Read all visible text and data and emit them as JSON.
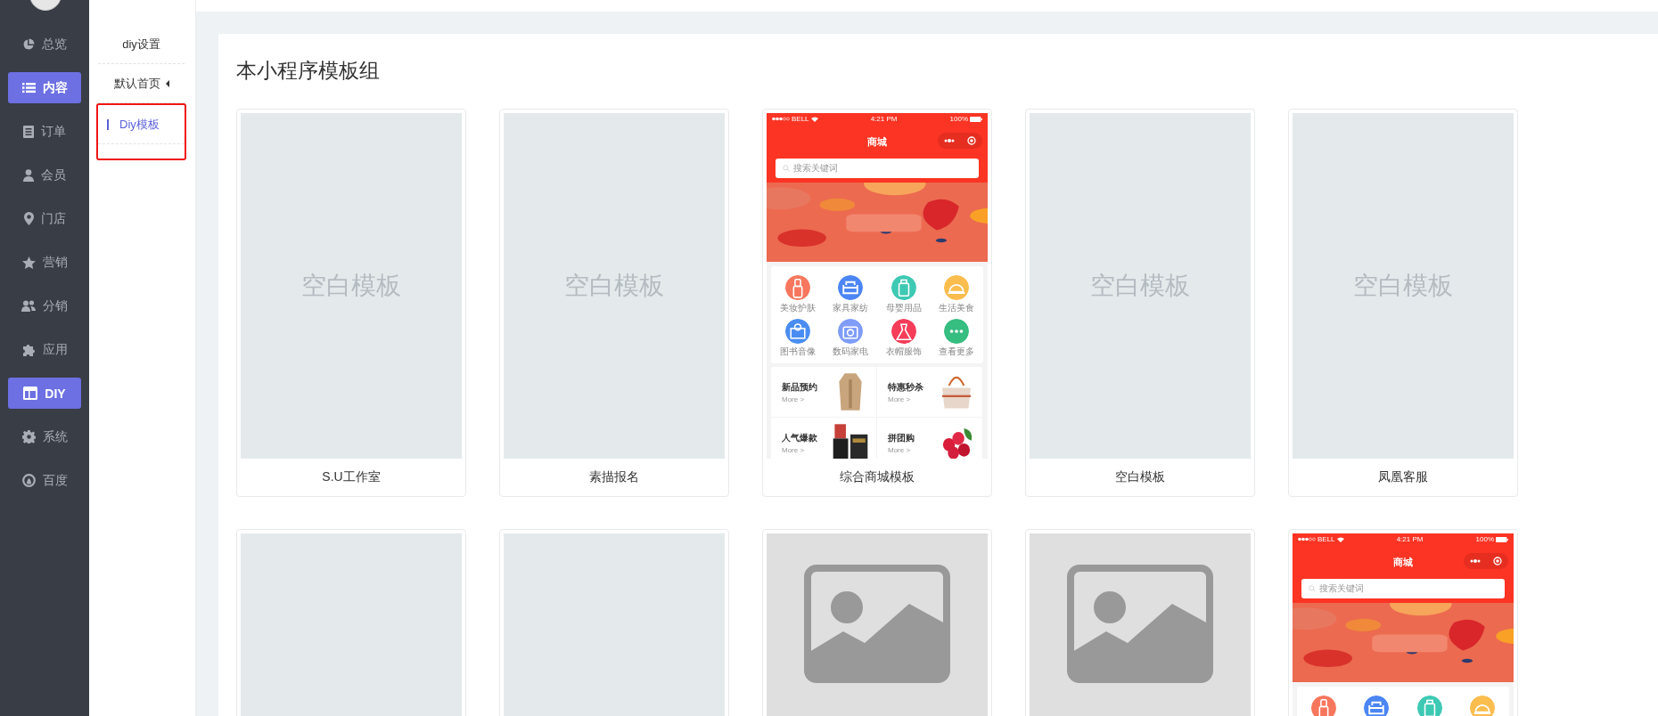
{
  "nav": {
    "items": [
      {
        "label": "总览",
        "selected": false
      },
      {
        "label": "内容",
        "selected": true
      },
      {
        "label": "订单",
        "selected": false
      },
      {
        "label": "会员",
        "selected": false
      },
      {
        "label": "门店",
        "selected": false
      },
      {
        "label": "营销",
        "selected": false
      },
      {
        "label": "分销",
        "selected": false
      },
      {
        "label": "应用",
        "selected": false
      },
      {
        "label": "DIY",
        "selected": true
      },
      {
        "label": "系统",
        "selected": false
      },
      {
        "label": "百度",
        "selected": false
      }
    ]
  },
  "subnav": {
    "items": [
      {
        "label": "diy设置",
        "selected": false,
        "annotated": false,
        "expanded": false
      },
      {
        "label": "默认首页",
        "selected": false,
        "annotated": false,
        "expanded": true
      },
      {
        "label": "Diy模板",
        "selected": true,
        "annotated": true,
        "expanded": false
      }
    ]
  },
  "panel": {
    "title": "本小程序模板组",
    "templates": [
      {
        "kind": "blank",
        "label": "空白模板",
        "caption": "S.U工作室"
      },
      {
        "kind": "blank",
        "label": "空白模板",
        "caption": "素描报名"
      },
      {
        "kind": "mall",
        "caption": "综合商城模板",
        "preview": {
          "carrier": "BELL",
          "time": "4:21 PM",
          "battery": "100%",
          "title": "商城",
          "search_placeholder": "搜索关键词",
          "categories": [
            {
              "label": "美妆护肤",
              "color": "#f7775e"
            },
            {
              "label": "家具家纺",
              "color": "#4c86f5"
            },
            {
              "label": "母婴用品",
              "color": "#3ec9b4"
            },
            {
              "label": "生活美食",
              "color": "#fbbd4e"
            },
            {
              "label": "图书音像",
              "color": "#4a8df2"
            },
            {
              "label": "数码家电",
              "color": "#7f9df8"
            },
            {
              "label": "衣帽服饰",
              "color": "#f53d5a"
            },
            {
              "label": "查看更多",
              "color": "#36bd80"
            }
          ],
          "promos": [
            {
              "title": "新品预约",
              "more": "More >"
            },
            {
              "title": "特惠秒杀",
              "more": "More >"
            },
            {
              "title": "人气爆款",
              "more": "More >"
            },
            {
              "title": "拼团购",
              "more": "More >"
            }
          ]
        }
      },
      {
        "kind": "blank",
        "label": "空白模板",
        "caption": "空白模板"
      },
      {
        "kind": "blank",
        "label": "空白模板",
        "caption": "凤凰客服"
      },
      {
        "kind": "blank"
      },
      {
        "kind": "blank"
      },
      {
        "kind": "no-image"
      },
      {
        "kind": "no-image"
      },
      {
        "kind": "mall",
        "preview": {
          "carrier": "BELL",
          "time": "4:21 PM",
          "battery": "100%",
          "title": "商城",
          "search_placeholder": "搜索关键词",
          "categories": [
            {
              "color": "#f7775e"
            },
            {
              "color": "#4c86f5"
            },
            {
              "color": "#3ec9b4"
            },
            {
              "color": "#fbbd4e"
            }
          ]
        }
      }
    ]
  }
}
